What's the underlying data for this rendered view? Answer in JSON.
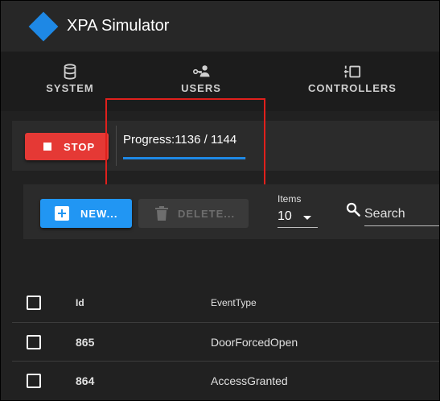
{
  "app": {
    "title": "XPA Simulator",
    "brand_color": "#1e88e5"
  },
  "nav": {
    "tabs": [
      {
        "label": "SYSTEM",
        "icon": "database-icon"
      },
      {
        "label": "USERS",
        "icon": "users-key-icon"
      },
      {
        "label": "CONTROLLERS",
        "icon": "controllers-icon"
      }
    ]
  },
  "run": {
    "stop_label": "STOP",
    "stop_color": "#e53935",
    "progress_label": "Progress:",
    "progress_text": "1136 / 1144",
    "progress_done": 1136,
    "progress_total": 1144,
    "progress_fraction": 0.993
  },
  "toolbar": {
    "new_label": "NEW...",
    "delete_label": "DELETE...",
    "items_label": "Items",
    "items_value": "10",
    "search_placeholder": "Search"
  },
  "table": {
    "columns": {
      "id": "Id",
      "event_type": "EventType"
    },
    "rows": [
      {
        "id": "865",
        "event_type": "DoorForcedOpen"
      },
      {
        "id": "864",
        "event_type": "AccessGranted"
      }
    ]
  }
}
